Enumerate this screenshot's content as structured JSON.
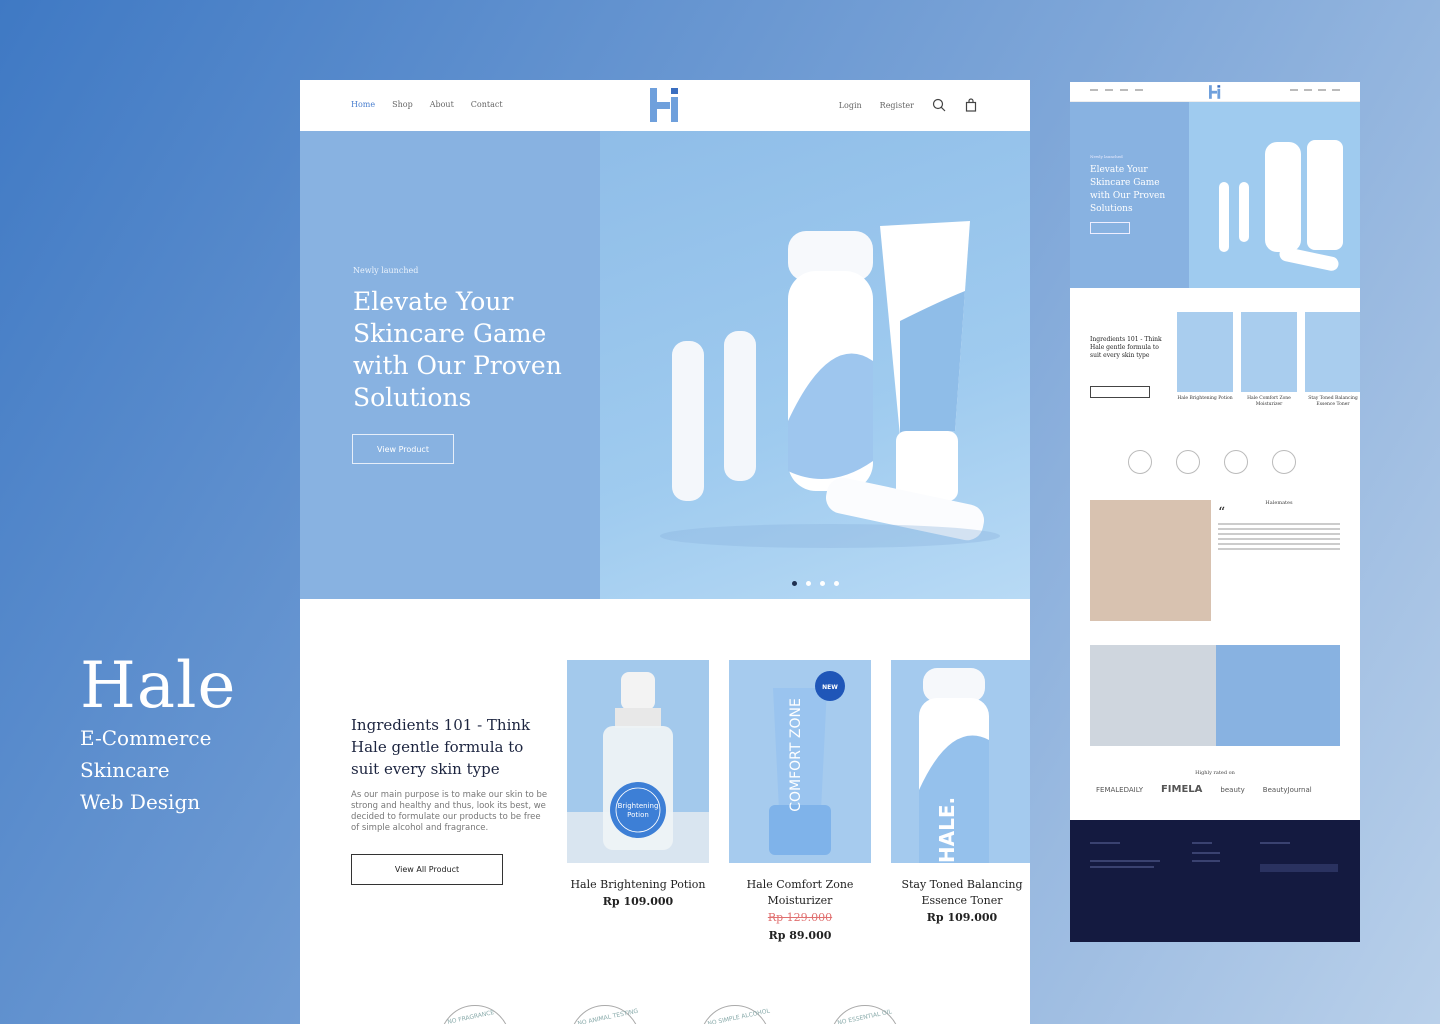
{
  "brand": {
    "name": "Hale",
    "lines": [
      "E-Commerce",
      "Skincare",
      "Web Design"
    ]
  },
  "nav": {
    "links": [
      "Home",
      "Shop",
      "About",
      "Contact"
    ],
    "active": "Home",
    "login": "Login",
    "register": "Register",
    "icons": [
      "search-icon",
      "shopping-bag-icon"
    ]
  },
  "hero": {
    "kicker": "Newly launched",
    "title": "Elevate Your Skincare Game with Our Proven Solutions",
    "button": "View Product",
    "slides": 4,
    "active_slide": 1
  },
  "ingredients": {
    "title": "Ingredients 101 - Think Hale gentle formula to suit every skin type",
    "body": "As our main purpose is to make our skin to be strong and healthy and thus, look its best, we decided to formulate our products to be free of simple alcohol and fragrance.",
    "button": "View All Product"
  },
  "products": [
    {
      "name": "Hale Brightening Potion",
      "price": "Rp 109.000",
      "old_price": "",
      "label": "Brightening Potion"
    },
    {
      "name": "Hale Comfort Zone Moisturizer",
      "price": "Rp 89.000",
      "old_price": "Rp 129.000",
      "badge": "NEW"
    },
    {
      "name": "Stay Toned Balancing Essence Toner",
      "price": "Rp 109.000",
      "old_price": ""
    }
  ],
  "badges": [
    "NO FRAGRANCE",
    "NO ANIMAL TESTING",
    "NO SIMPLE ALCOHOL",
    "NO ESSENTIAL OIL"
  ],
  "mobile": {
    "hero_title": "Elevate Your Skincare Game with Our Proven Solutions",
    "ingredients_title": "Ingredients 101 - Think Hale gentle formula to suit every skin type",
    "products": [
      "Hale Brightening Potion",
      "Hale Comfort Zone Moisturizer",
      "Stay Toned Balancing Essence Toner"
    ],
    "testimonial_title": "Halemates",
    "rated": "Highly rated on",
    "logos": [
      "FEMALEDAILY",
      "FIMELA",
      "beauty",
      "BeautyJournal"
    ]
  },
  "colors": {
    "hero_bg": "#88b2e1",
    "accent": "#4a7fcf",
    "sale": "#e07070",
    "footer": "#141a40"
  }
}
